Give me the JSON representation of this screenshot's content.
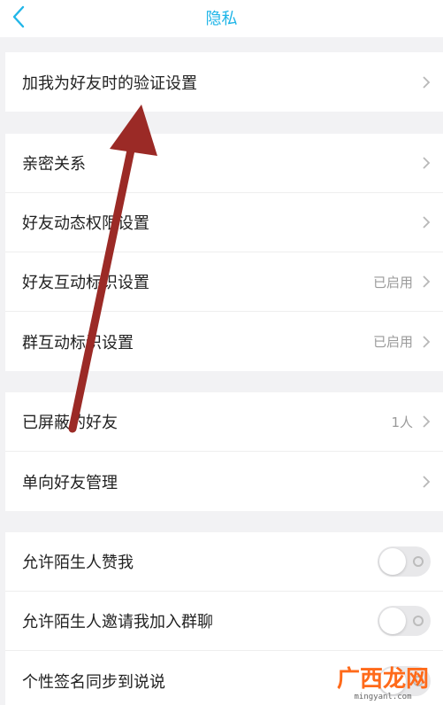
{
  "header": {
    "title": "隐私",
    "back_icon": "chevron-left-icon",
    "accent_color": "#21b6e8"
  },
  "groups": [
    {
      "items": [
        {
          "label": "加我为好友时的验证设置",
          "value": ""
        }
      ]
    },
    {
      "items": [
        {
          "label": "亲密关系",
          "value": ""
        },
        {
          "label": "好友动态权限设置",
          "value": ""
        },
        {
          "label": "好友互动标识设置",
          "value": "已启用"
        },
        {
          "label": "群互动标识设置",
          "value": "已启用"
        }
      ]
    },
    {
      "items": [
        {
          "label": "已屏蔽的好友",
          "value": "1人"
        },
        {
          "label": "单向好友管理",
          "value": ""
        }
      ]
    },
    {
      "items": [
        {
          "label": "允许陌生人赞我",
          "toggle": false
        },
        {
          "label": "允许陌生人邀请我加入群聊",
          "toggle": false
        },
        {
          "label": "个性签名同步到说说",
          "toggle": false
        }
      ]
    }
  ],
  "annotation": {
    "arrow_color": "#9b2a26"
  },
  "watermark": {
    "text": "广西龙网",
    "url": "mingyanl.com"
  }
}
